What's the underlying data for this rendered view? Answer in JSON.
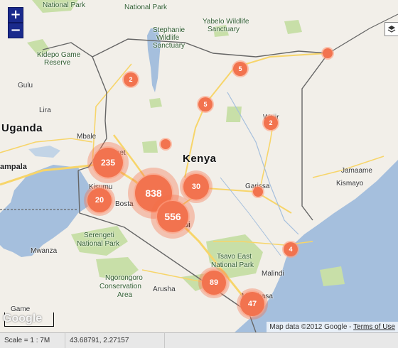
{
  "map": {
    "labels": {
      "national_park": "National Park",
      "national_park_2": "National Park",
      "stephanie": "Stephanie",
      "wildlife": "Wildlife",
      "sanctuary": "Sanctuary",
      "yabelo": "Yabelo Wildlife",
      "yabelo_sanct": "Sanctuary",
      "kidepo": "Kidepo Game",
      "reserve": "Reserve",
      "gulu": "Gulu",
      "lira": "Lira",
      "uganda": "Uganda",
      "kenya": "Kenya",
      "mbale": "Mbale",
      "eldoret": "Eldoret",
      "kisumu": "Kisumu",
      "kampala": "ampala",
      "bosta": "Bosta",
      "nairobi": "Nairobi",
      "garissa": "Garissa",
      "wajir": "Wajir",
      "jamaame": "Jamaame",
      "kismayo": "Kismayo",
      "serengeti": "Serengeti",
      "serengeti_np": "National Park",
      "mwanza": "Mwanza",
      "ngorongoro": "Ngorongoro",
      "conservation": "Conservation",
      "area": "Area",
      "arusha": "Arusha",
      "tsavo": "Tsavo East",
      "tsavo_np": "National Park",
      "malindi": "Malindi",
      "mombasa": "Mombasa",
      "dodoma_game": "Game"
    },
    "clusters": [
      {
        "count": "2",
        "name": "cluster-2-north"
      },
      {
        "count": "5",
        "name": "cluster-5-north"
      },
      {
        "count": "",
        "name": "cluster-ne-dot"
      },
      {
        "count": "5",
        "name": "cluster-5-central"
      },
      {
        "count": "2",
        "name": "cluster-2-wajir"
      },
      {
        "count": "",
        "name": "cluster-center-dot"
      },
      {
        "count": "235",
        "name": "cluster-235"
      },
      {
        "count": "838",
        "name": "cluster-838"
      },
      {
        "count": "30",
        "name": "cluster-30"
      },
      {
        "count": "20",
        "name": "cluster-20"
      },
      {
        "count": "556",
        "name": "cluster-556"
      },
      {
        "count": "",
        "name": "cluster-garissa-dot"
      },
      {
        "count": "4",
        "name": "cluster-4"
      },
      {
        "count": "89",
        "name": "cluster-89"
      },
      {
        "count": "47",
        "name": "cluster-47"
      }
    ],
    "zoom_in_label": "+",
    "zoom_out_label": "−",
    "attribution_text": "Map data ©2012 Google - ",
    "terms_text": "Terms of Use",
    "google_logo": "Google"
  },
  "statusbar": {
    "scale": "Scale = 1 : 7M",
    "coords": "43.68791, 2.27157"
  },
  "colors": {
    "water": "#a5bfdd",
    "land": "#f2efe9",
    "park": "#c8dfa8",
    "cluster": "#f2734f",
    "road": "#f7d56a"
  }
}
